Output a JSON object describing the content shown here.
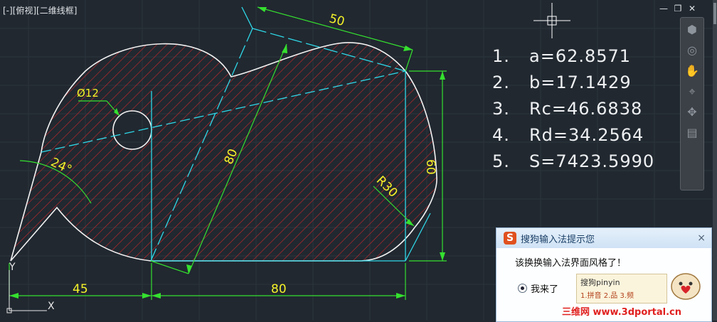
{
  "viewport": {
    "label": "[-][俯视][二维线框]"
  },
  "window_controls": {
    "minimize_icon": "minimize-icon",
    "restore_icon": "restore-icon",
    "close_icon": "close-icon"
  },
  "colors": {
    "background": "#212830",
    "outline": "#f2f2f2",
    "hatch": "#c0282a",
    "dimension": "#35e02f",
    "construction": "#2fd8e8",
    "dim_text": "#f5f229"
  },
  "dimensions": {
    "d50": "50",
    "d80_diag": "80",
    "d60": "60",
    "d45": "45",
    "d80_base": "80",
    "dia": "Ø12",
    "angle": "24°",
    "radius": "R30"
  },
  "ucs": {
    "y": "Y",
    "x": "X"
  },
  "results": [
    {
      "num": "1.",
      "text": "a=62.8571"
    },
    {
      "num": "2.",
      "text": "b=17.1429"
    },
    {
      "num": "3.",
      "text": "Rc=46.6838"
    },
    {
      "num": "4.",
      "text": "Rd=34.2564"
    },
    {
      "num": "5.",
      "text": "S=7423.5990"
    }
  ],
  "nav_bar": [
    "viewcube-icon",
    "steering-wheel-icon",
    "pan-icon",
    "zoom-icon",
    "orbit-icon",
    "showmotion-icon"
  ],
  "ime": {
    "title": "搜狗输入法提示您",
    "message": "该换换输入法界面风格了！",
    "option": "我来了",
    "preview_word": "搜狗pinyin",
    "preview_candidates": "1.拼音 2.品 3.频",
    "close": "×"
  },
  "watermark": "三维网 www.3dportal.cn"
}
